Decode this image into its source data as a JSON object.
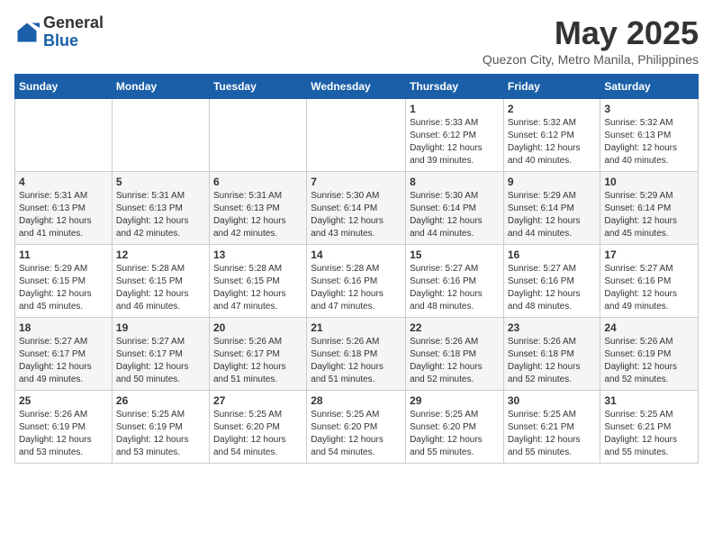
{
  "header": {
    "logo_line1": "General",
    "logo_line2": "Blue",
    "month_title": "May 2025",
    "location": "Quezon City, Metro Manila, Philippines"
  },
  "days_of_week": [
    "Sunday",
    "Monday",
    "Tuesday",
    "Wednesday",
    "Thursday",
    "Friday",
    "Saturday"
  ],
  "weeks": [
    [
      {
        "day": "",
        "info": ""
      },
      {
        "day": "",
        "info": ""
      },
      {
        "day": "",
        "info": ""
      },
      {
        "day": "",
        "info": ""
      },
      {
        "day": "1",
        "info": "Sunrise: 5:33 AM\nSunset: 6:12 PM\nDaylight: 12 hours\nand 39 minutes."
      },
      {
        "day": "2",
        "info": "Sunrise: 5:32 AM\nSunset: 6:12 PM\nDaylight: 12 hours\nand 40 minutes."
      },
      {
        "day": "3",
        "info": "Sunrise: 5:32 AM\nSunset: 6:13 PM\nDaylight: 12 hours\nand 40 minutes."
      }
    ],
    [
      {
        "day": "4",
        "info": "Sunrise: 5:31 AM\nSunset: 6:13 PM\nDaylight: 12 hours\nand 41 minutes."
      },
      {
        "day": "5",
        "info": "Sunrise: 5:31 AM\nSunset: 6:13 PM\nDaylight: 12 hours\nand 42 minutes."
      },
      {
        "day": "6",
        "info": "Sunrise: 5:31 AM\nSunset: 6:13 PM\nDaylight: 12 hours\nand 42 minutes."
      },
      {
        "day": "7",
        "info": "Sunrise: 5:30 AM\nSunset: 6:14 PM\nDaylight: 12 hours\nand 43 minutes."
      },
      {
        "day": "8",
        "info": "Sunrise: 5:30 AM\nSunset: 6:14 PM\nDaylight: 12 hours\nand 44 minutes."
      },
      {
        "day": "9",
        "info": "Sunrise: 5:29 AM\nSunset: 6:14 PM\nDaylight: 12 hours\nand 44 minutes."
      },
      {
        "day": "10",
        "info": "Sunrise: 5:29 AM\nSunset: 6:14 PM\nDaylight: 12 hours\nand 45 minutes."
      }
    ],
    [
      {
        "day": "11",
        "info": "Sunrise: 5:29 AM\nSunset: 6:15 PM\nDaylight: 12 hours\nand 45 minutes."
      },
      {
        "day": "12",
        "info": "Sunrise: 5:28 AM\nSunset: 6:15 PM\nDaylight: 12 hours\nand 46 minutes."
      },
      {
        "day": "13",
        "info": "Sunrise: 5:28 AM\nSunset: 6:15 PM\nDaylight: 12 hours\nand 47 minutes."
      },
      {
        "day": "14",
        "info": "Sunrise: 5:28 AM\nSunset: 6:16 PM\nDaylight: 12 hours\nand 47 minutes."
      },
      {
        "day": "15",
        "info": "Sunrise: 5:27 AM\nSunset: 6:16 PM\nDaylight: 12 hours\nand 48 minutes."
      },
      {
        "day": "16",
        "info": "Sunrise: 5:27 AM\nSunset: 6:16 PM\nDaylight: 12 hours\nand 48 minutes."
      },
      {
        "day": "17",
        "info": "Sunrise: 5:27 AM\nSunset: 6:16 PM\nDaylight: 12 hours\nand 49 minutes."
      }
    ],
    [
      {
        "day": "18",
        "info": "Sunrise: 5:27 AM\nSunset: 6:17 PM\nDaylight: 12 hours\nand 49 minutes."
      },
      {
        "day": "19",
        "info": "Sunrise: 5:27 AM\nSunset: 6:17 PM\nDaylight: 12 hours\nand 50 minutes."
      },
      {
        "day": "20",
        "info": "Sunrise: 5:26 AM\nSunset: 6:17 PM\nDaylight: 12 hours\nand 51 minutes."
      },
      {
        "day": "21",
        "info": "Sunrise: 5:26 AM\nSunset: 6:18 PM\nDaylight: 12 hours\nand 51 minutes."
      },
      {
        "day": "22",
        "info": "Sunrise: 5:26 AM\nSunset: 6:18 PM\nDaylight: 12 hours\nand 52 minutes."
      },
      {
        "day": "23",
        "info": "Sunrise: 5:26 AM\nSunset: 6:18 PM\nDaylight: 12 hours\nand 52 minutes."
      },
      {
        "day": "24",
        "info": "Sunrise: 5:26 AM\nSunset: 6:19 PM\nDaylight: 12 hours\nand 52 minutes."
      }
    ],
    [
      {
        "day": "25",
        "info": "Sunrise: 5:26 AM\nSunset: 6:19 PM\nDaylight: 12 hours\nand 53 minutes."
      },
      {
        "day": "26",
        "info": "Sunrise: 5:25 AM\nSunset: 6:19 PM\nDaylight: 12 hours\nand 53 minutes."
      },
      {
        "day": "27",
        "info": "Sunrise: 5:25 AM\nSunset: 6:20 PM\nDaylight: 12 hours\nand 54 minutes."
      },
      {
        "day": "28",
        "info": "Sunrise: 5:25 AM\nSunset: 6:20 PM\nDaylight: 12 hours\nand 54 minutes."
      },
      {
        "day": "29",
        "info": "Sunrise: 5:25 AM\nSunset: 6:20 PM\nDaylight: 12 hours\nand 55 minutes."
      },
      {
        "day": "30",
        "info": "Sunrise: 5:25 AM\nSunset: 6:21 PM\nDaylight: 12 hours\nand 55 minutes."
      },
      {
        "day": "31",
        "info": "Sunrise: 5:25 AM\nSunset: 6:21 PM\nDaylight: 12 hours\nand 55 minutes."
      }
    ]
  ]
}
